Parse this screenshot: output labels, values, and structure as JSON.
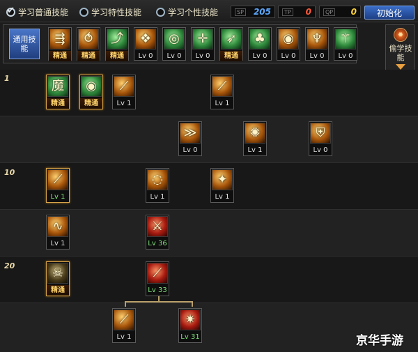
{
  "tabs": [
    {
      "label": "学习普通技能",
      "selected": true
    },
    {
      "label": "学习特性技能",
      "selected": false
    },
    {
      "label": "学习个性技能",
      "selected": false
    }
  ],
  "stats": [
    {
      "tag": "SP",
      "value": "205",
      "color": "#5aa8ff"
    },
    {
      "tag": "TP",
      "value": "0",
      "color": "#ff5a3a"
    },
    {
      "tag": "QP",
      "value": "0",
      "color": "#ffd23a"
    }
  ],
  "reset_label": "初始化",
  "common": {
    "label": "通用技能",
    "skills": [
      {
        "icon": "run-icon",
        "glyph": "⇶",
        "tone": "gold",
        "caption": "精通"
      },
      {
        "icon": "crouch-icon",
        "glyph": "⥀",
        "tone": "gold",
        "caption": "精通"
      },
      {
        "icon": "leap-icon",
        "glyph": "⤴",
        "tone": "green",
        "caption": "精通"
      },
      {
        "icon": "wings-icon",
        "glyph": "❖",
        "tone": "gold",
        "caption": "Lv 0"
      },
      {
        "icon": "target-icon",
        "glyph": "◎",
        "tone": "green",
        "caption": "Lv 0"
      },
      {
        "icon": "crosshair-icon",
        "glyph": "✛",
        "tone": "green",
        "caption": "Lv 0"
      },
      {
        "icon": "dash-icon",
        "glyph": "➶",
        "tone": "green",
        "caption": "精通"
      },
      {
        "icon": "mushroom-icon",
        "glyph": "♣",
        "tone": "green",
        "caption": "Lv 0"
      },
      {
        "icon": "eye-icon",
        "glyph": "◉",
        "tone": "gold",
        "caption": "Lv 0"
      },
      {
        "icon": "muscle-icon",
        "glyph": "♆",
        "tone": "gold",
        "caption": "Lv 0"
      },
      {
        "icon": "climb-icon",
        "glyph": "⚚",
        "tone": "green",
        "caption": "Lv 0"
      }
    ]
  },
  "side": {
    "label": "偷学技能",
    "icon": "flame-icon"
  },
  "levels": [
    "1",
    "10",
    "20"
  ],
  "tree": [
    {
      "icon": "demon-icon",
      "glyph": "魔",
      "tone": "green",
      "caption": "精通",
      "sel": true
    },
    {
      "icon": "eye-icon",
      "glyph": "◉",
      "tone": "green",
      "caption": "精通",
      "sel": true
    },
    {
      "icon": "slash-icon",
      "glyph": "⟋",
      "tone": "gold",
      "caption": "Lv 1",
      "sel": false
    },
    {
      "icon": "slash-icon",
      "glyph": "⟋",
      "tone": "gold",
      "caption": "Lv 1",
      "sel": false
    },
    {
      "icon": "arrows-icon",
      "glyph": "≫",
      "tone": "gold",
      "caption": "Lv 0",
      "sel": false
    },
    {
      "icon": "burst-icon",
      "glyph": "✺",
      "tone": "gold",
      "caption": "Lv 1",
      "sel": false
    },
    {
      "icon": "shield-icon",
      "glyph": "⛨",
      "tone": "gold",
      "caption": "Lv 0",
      "sel": false
    },
    {
      "icon": "slash-icon",
      "glyph": "⟋",
      "tone": "gold",
      "caption": "Lv 1",
      "sel": true
    },
    {
      "icon": "spin-icon",
      "glyph": "◌",
      "tone": "gold",
      "caption": "Lv 1",
      "sel": false
    },
    {
      "icon": "phoenix-icon",
      "glyph": "✦",
      "tone": "gold",
      "caption": "Lv 1",
      "sel": false
    },
    {
      "icon": "whirl-icon",
      "glyph": "∿",
      "tone": "gold",
      "caption": "Lv 1",
      "sel": false
    },
    {
      "icon": "blade-icon",
      "glyph": "⚔",
      "tone": "red",
      "caption": "Lv 36",
      "sel": false
    },
    {
      "icon": "skull-icon",
      "glyph": "☠",
      "tone": "dark",
      "caption": "精通",
      "sel": true
    },
    {
      "icon": "claw-icon",
      "glyph": "⟋",
      "tone": "red",
      "caption": "Lv 33",
      "sel": false
    },
    {
      "icon": "slash-icon",
      "glyph": "⟋",
      "tone": "gold",
      "caption": "Lv 1",
      "sel": false
    },
    {
      "icon": "fire-slash-icon",
      "glyph": "✷",
      "tone": "red",
      "caption": "Lv 31",
      "sel": false
    }
  ],
  "watermark": "京华手游"
}
